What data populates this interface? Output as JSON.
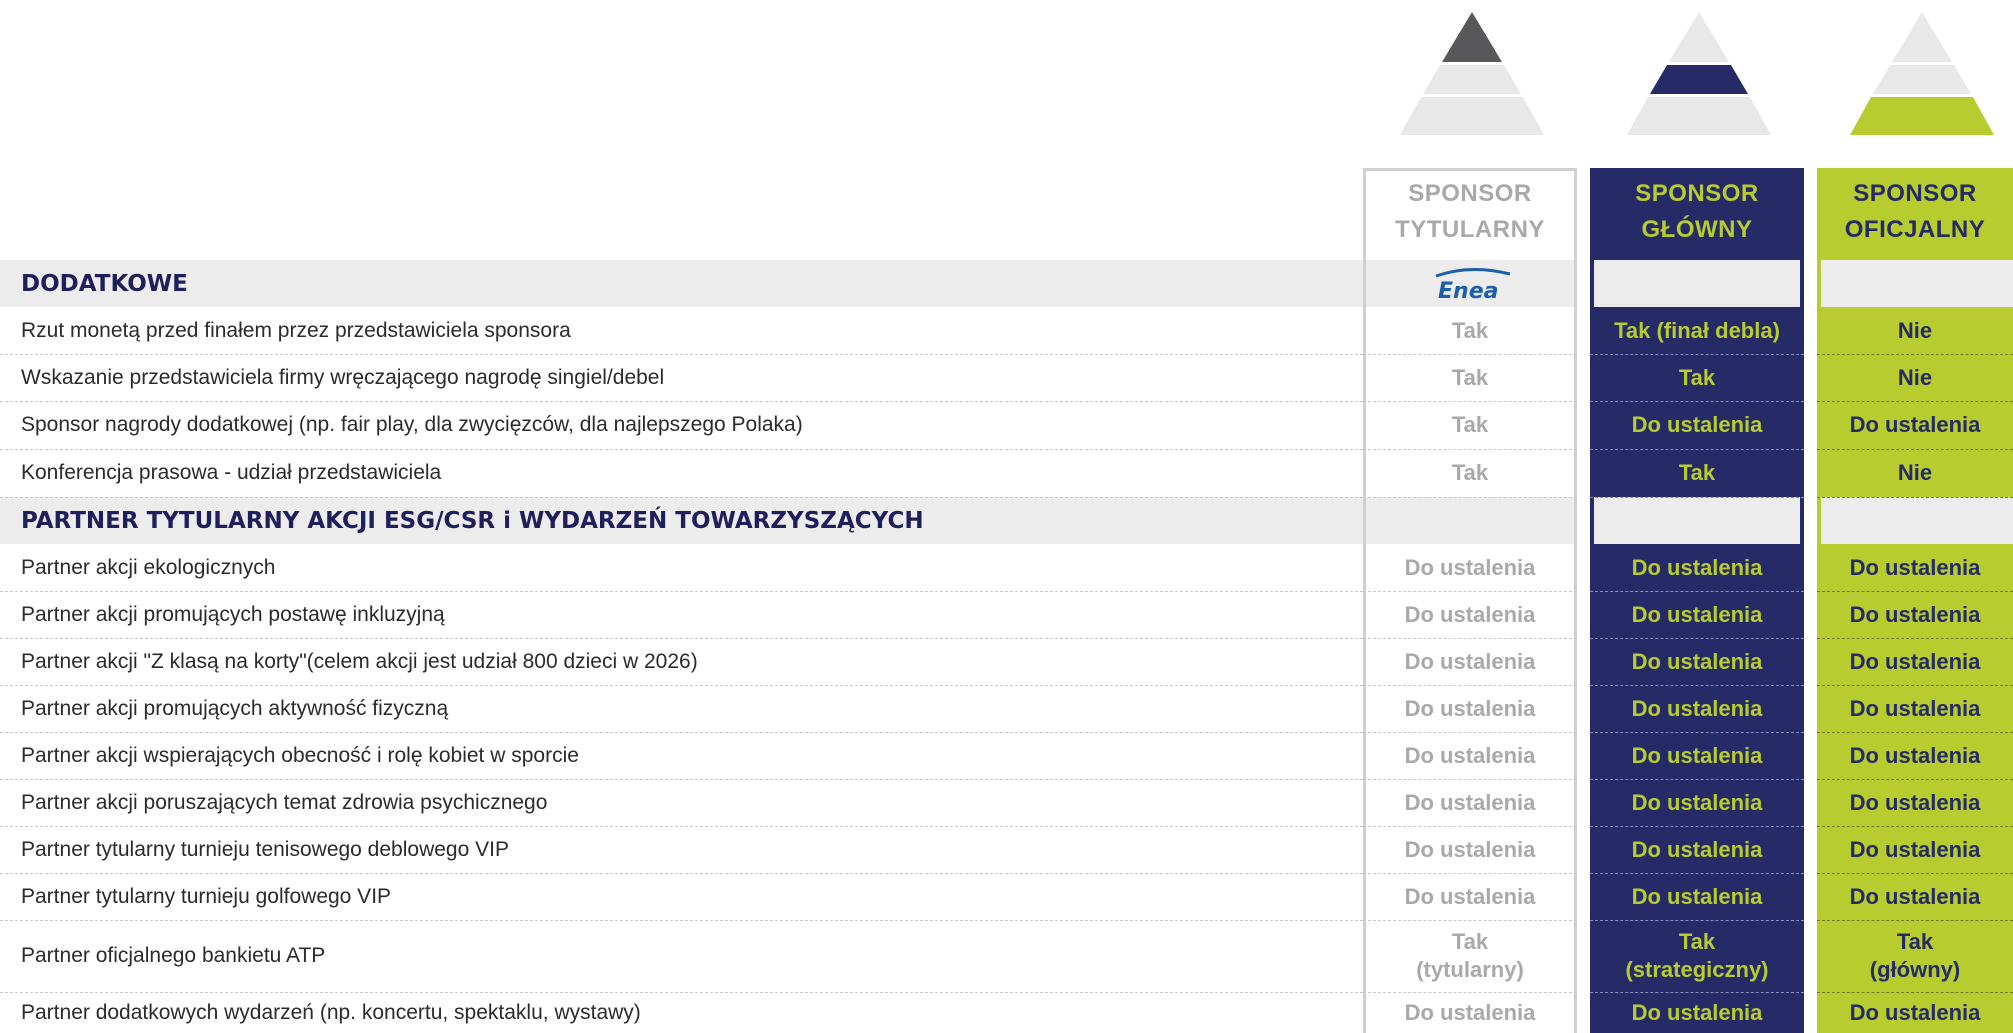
{
  "columns": {
    "tytularny": "SPONSOR\nTYTULARNY",
    "tytularny_l1": "SPONSOR",
    "tytularny_l2": "TYTULARNY",
    "glowny_l1": "SPONSOR",
    "glowny_l2": "GŁÓWNY",
    "oficjalny_l1": "SPONSOR",
    "oficjalny_l2": "OFICJALNY"
  },
  "colors": {
    "navy": "#262a66",
    "lime": "#b7cc2e",
    "gray_text": "#a9a9a9",
    "section_band": "#ececec",
    "pyramid_dark": "#58585a",
    "pyramid_light": "#e8e8e8"
  },
  "logo": {
    "text": "Enea",
    "icon": "enea-logo"
  },
  "sections": [
    {
      "title": "DODATKOWE"
    },
    {
      "title": "PARTNER TYTULARNY AKCJI ESG/CSR i WYDARZEŃ TOWARZYSZĄCYCH"
    }
  ],
  "rows": [
    {
      "label": "Rzut monetą przed finałem przez przedstawiciela sponsora",
      "tytularny": "Tak",
      "glowny": "Tak (finał debla)",
      "oficjalny": "Nie"
    },
    {
      "label": "Wskazanie przedstawiciela firmy wręczającego nagrodę singiel/debel",
      "tytularny": "Tak",
      "glowny": "Tak",
      "oficjalny": "Nie"
    },
    {
      "label": "Sponsor nagrody dodatkowej (np. fair play, dla zwycięzców, dla najlepszego Polaka)",
      "tytularny": "Tak",
      "glowny": "Do ustalenia",
      "oficjalny": "Do ustalenia"
    },
    {
      "label": "Konferencja prasowa - udział przedstawiciela",
      "tytularny": "Tak",
      "glowny": "Tak",
      "oficjalny": "Nie"
    },
    {
      "label": "Partner akcji ekologicznych",
      "tytularny": "Do ustalenia",
      "glowny": "Do ustalenia",
      "oficjalny": "Do ustalenia"
    },
    {
      "label": "Partner akcji promujących postawę inkluzyjną",
      "tytularny": "Do ustalenia",
      "glowny": "Do ustalenia",
      "oficjalny": "Do ustalenia"
    },
    {
      "label": "Partner akcji \"Z klasą na korty\"(celem akcji jest udział 800 dzieci w 2026)",
      "tytularny": "Do ustalenia",
      "glowny": "Do ustalenia",
      "oficjalny": "Do ustalenia"
    },
    {
      "label": "Partner akcji promujących aktywność fizyczną",
      "tytularny": "Do ustalenia",
      "glowny": "Do ustalenia",
      "oficjalny": "Do ustalenia"
    },
    {
      "label": "Partner akcji wspierających obecność i rolę kobiet w sporcie",
      "tytularny": "Do ustalenia",
      "glowny": "Do ustalenia",
      "oficjalny": "Do ustalenia"
    },
    {
      "label": "Partner akcji poruszających temat zdrowia psychicznego",
      "tytularny": "Do ustalenia",
      "glowny": "Do ustalenia",
      "oficjalny": "Do ustalenia"
    },
    {
      "label": "Partner tytularny turnieju tenisowego deblowego VIP",
      "tytularny": "Do ustalenia",
      "glowny": "Do ustalenia",
      "oficjalny": "Do ustalenia"
    },
    {
      "label": "Partner tytularny turnieju golfowego VIP",
      "tytularny": "Do ustalenia",
      "glowny": "Do ustalenia",
      "oficjalny": "Do ustalenia"
    },
    {
      "label": "Partner oficjalnego bankietu ATP",
      "tytularny_l1": "Tak",
      "tytularny_l2": "(tytularny)",
      "glowny_l1": "Tak",
      "glowny_l2": "(strategiczny)",
      "oficjalny_l1": "Tak",
      "oficjalny_l2": "(główny)"
    },
    {
      "label": "Partner dodatkowych wydarzeń (np. koncertu, spektaklu, wystawy)",
      "tytularny": "Do ustalenia",
      "glowny": "Do ustalenia",
      "oficjalny": "Do ustalenia"
    }
  ]
}
